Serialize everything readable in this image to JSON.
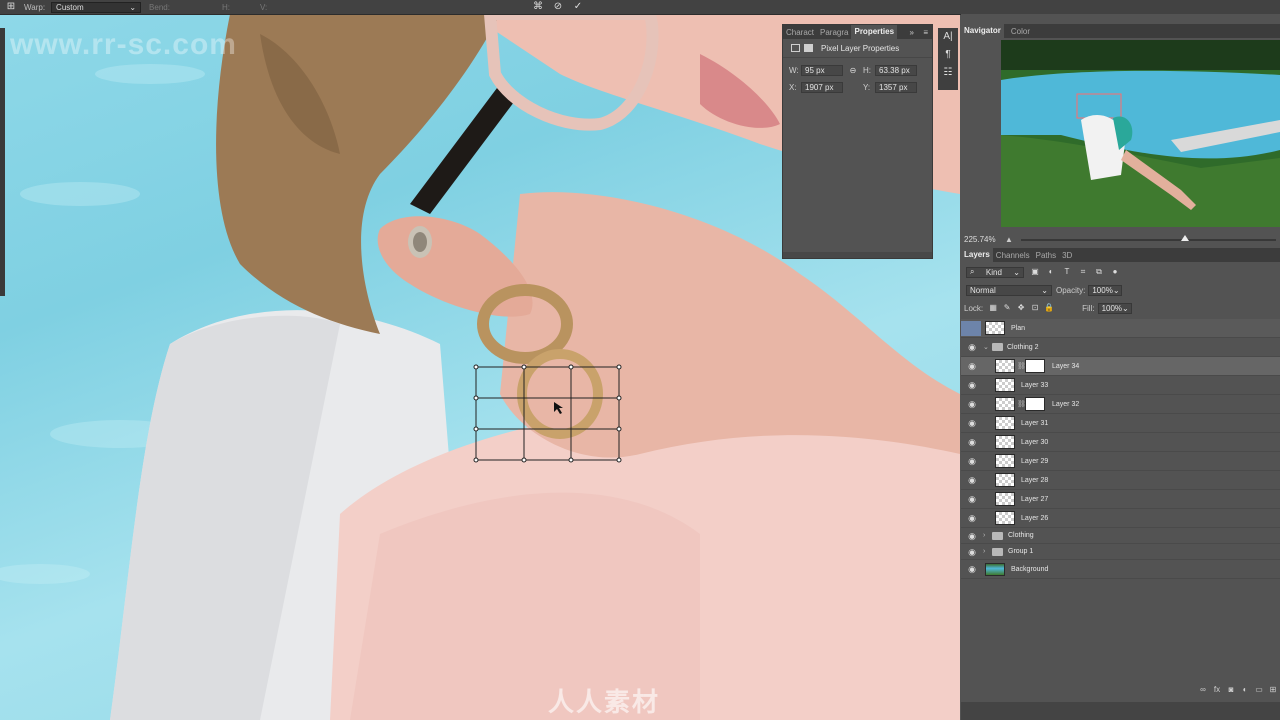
{
  "options_bar": {
    "warp_label": "Warp:",
    "warp_value": "Custom",
    "bend_label": "Bend:",
    "h_label": "H:",
    "v_label": "V:"
  },
  "watermark": {
    "text": "www.rr-sc.com",
    "bottom_logo": "人人素材"
  },
  "properties_panel": {
    "tabs": [
      "Charact",
      "Paragra",
      "Properties"
    ],
    "active_tab": "Properties",
    "heading": "Pixel Layer Properties",
    "w_label": "W:",
    "w_value": "95 px",
    "h_label": "H:",
    "h_value": "63.38 px",
    "x_label": "X:",
    "x_value": "1907 px",
    "y_label": "Y:",
    "y_value": "1357 px"
  },
  "navigator": {
    "tabs": [
      "Navigator",
      "Color"
    ],
    "zoom": "225.74%"
  },
  "layers_panel": {
    "tabs": [
      "Layers",
      "Channels",
      "Paths",
      "3D"
    ],
    "filter": "Kind",
    "blend_mode": "Normal",
    "opacity_label": "Opacity:",
    "opacity_value": "100%",
    "lock_label": "Lock:",
    "fill_label": "Fill:",
    "fill_value": "100%",
    "layers": [
      {
        "name": "Plan"
      },
      {
        "name": "Clothing 2"
      },
      {
        "name": "Layer 34"
      },
      {
        "name": "Layer 33"
      },
      {
        "name": "Layer 32"
      },
      {
        "name": "Layer 31"
      },
      {
        "name": "Layer 30"
      },
      {
        "name": "Layer 29"
      },
      {
        "name": "Layer 28"
      },
      {
        "name": "Layer 27"
      },
      {
        "name": "Layer 26"
      },
      {
        "name": "Clothing"
      },
      {
        "name": "Group 1"
      },
      {
        "name": "Background"
      }
    ]
  },
  "colors": {
    "panel_bg": "#535353",
    "selected_layer": "#666666",
    "pool_water": "#8ed8e8",
    "skin": "#f2cbc4"
  }
}
